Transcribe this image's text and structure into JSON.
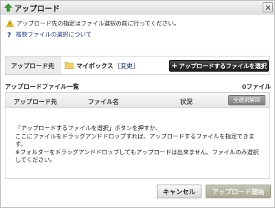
{
  "dialog": {
    "title": "アップロード",
    "close_label": "×"
  },
  "notice": {
    "text": "アップロード先の指定はファイル選択の前に行ってください。"
  },
  "help": {
    "link": "複数ファイルの選択について"
  },
  "destination": {
    "label": "アップロード先",
    "folder": "マイボックス",
    "change": "［変更］",
    "select_button": "アップロードするファイルを選択",
    "select_plus": "+"
  },
  "file_list": {
    "title": "アップロードファイル一覧",
    "count": "0ファイル",
    "columns": [
      "アップロード先",
      "ファイル名",
      "状況"
    ],
    "deselect_all": "全選択解除",
    "instructions": [
      "「アップロードするファイルを選択」ボタンを押すか、",
      "ここにファイルをドラッグアンドドロップすれば、アップロードするファイルを指定できます。",
      "※フォルダーをドラッグアンドドロップしてもアップロードは出来ません。ファイルのみ選択してください。"
    ]
  },
  "footer": {
    "cancel": "キャンセル",
    "start": "アップロード開始"
  },
  "colors": {
    "accent_link": "#1d3b8f",
    "title_icon": "#3a9b2f",
    "warning": "#f2c200"
  }
}
